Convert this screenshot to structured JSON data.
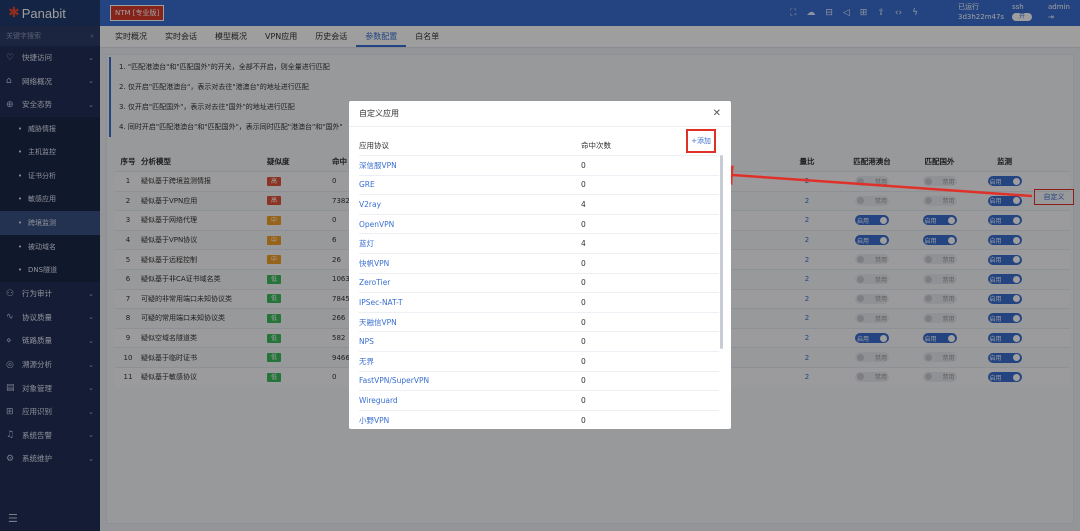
{
  "topbar": {
    "logo": "Panabit",
    "edition": "NTM [专业版]",
    "uptime_label": "已运行",
    "uptime": "3d3h22m47s",
    "ssh": "ssh",
    "ssh_toggle": "开",
    "admin": "admin"
  },
  "sidebar": {
    "search_placeholder": "关键字搜索",
    "items": [
      {
        "label": "快捷访问",
        "icon": "♡"
      },
      {
        "label": "网络概况",
        "icon": "⌂"
      },
      {
        "label": "安全态势",
        "icon": "⊕"
      }
    ],
    "subitems": [
      {
        "label": "威胁情报"
      },
      {
        "label": "主机监控"
      },
      {
        "label": "证书分析"
      },
      {
        "label": "敏感应用"
      },
      {
        "label": "跨境监测"
      },
      {
        "label": "被动域名"
      },
      {
        "label": "DNS隧道"
      }
    ],
    "items2": [
      {
        "label": "行为审计",
        "icon": "⚇"
      },
      {
        "label": "协议质量",
        "icon": "∿"
      },
      {
        "label": "链路质量",
        "icon": "⋄"
      },
      {
        "label": "溯源分析",
        "icon": "◎"
      },
      {
        "label": "对象管理",
        "icon": "▤"
      },
      {
        "label": "应用识别",
        "icon": "⊞"
      },
      {
        "label": "系统告警",
        "icon": "♫"
      },
      {
        "label": "系统维护",
        "icon": "⚙"
      }
    ]
  },
  "tabs": [
    "实时概况",
    "实时会话",
    "模型概况",
    "VPN应用",
    "历史会话",
    "参数配置",
    "白名单"
  ],
  "notes": [
    "1. \"匹配港澳台\"和\"匹配国外\"的开关，全部不开启，则全量进行匹配",
    "2. 仅开启\"匹配港澳台\"，表示对去往\"港澳台\"的地址进行匹配",
    "3. 仅开启\"匹配国外\"，表示对去往\"国外\"的地址进行匹配",
    "4. 同时开启\"匹配港澳台\"和\"匹配国外\"，表示同时匹配\"港澳台\"和\"国外\""
  ],
  "table": {
    "headers": {
      "no": "序号",
      "model": "分析模型",
      "level": "疑似度",
      "hits": "命中",
      "count": "量比",
      "hkmt": "匹配港澳台",
      "foreign": "匹配国外",
      "monitor": "监测"
    },
    "rows": [
      {
        "no": "1",
        "model": "疑似基于跨境监测情报",
        "level": "高",
        "lv": "hi",
        "hits": "0",
        "count": "2",
        "hkmt": "禁用",
        "hk_on": false,
        "foreign": "禁用",
        "fo_on": false,
        "monitor": "启用"
      },
      {
        "no": "2",
        "model": "疑似基于VPN应用",
        "level": "高",
        "lv": "hi",
        "hits": "7382",
        "count": "2",
        "hkmt": "禁用",
        "hk_on": false,
        "foreign": "禁用",
        "fo_on": false,
        "monitor": "启用"
      },
      {
        "no": "3",
        "model": "疑似基于网络代理",
        "level": "中",
        "lv": "mid",
        "hits": "0",
        "count": "2",
        "hkmt": "启用",
        "hk_on": true,
        "foreign": "启用",
        "fo_on": true,
        "monitor": "启用"
      },
      {
        "no": "4",
        "model": "疑似基于VPN协议",
        "level": "中",
        "lv": "mid",
        "hits": "6",
        "count": "2",
        "hkmt": "启用",
        "hk_on": true,
        "foreign": "启用",
        "fo_on": true,
        "monitor": "启用"
      },
      {
        "no": "5",
        "model": "疑似基于远程控制",
        "level": "中",
        "lv": "mid",
        "hits": "26",
        "count": "2",
        "hkmt": "禁用",
        "hk_on": false,
        "foreign": "禁用",
        "fo_on": false,
        "monitor": "启用"
      },
      {
        "no": "6",
        "model": "疑似基于非CA证书域名类",
        "level": "低",
        "lv": "lo",
        "hits": "1063",
        "count": "2",
        "hkmt": "禁用",
        "hk_on": false,
        "foreign": "禁用",
        "fo_on": false,
        "monitor": "启用"
      },
      {
        "no": "7",
        "model": "可疑的非常用端口未知协议类",
        "level": "低",
        "lv": "lo",
        "hits": "7845",
        "count": "2",
        "hkmt": "禁用",
        "hk_on": false,
        "foreign": "禁用",
        "fo_on": false,
        "monitor": "启用"
      },
      {
        "no": "8",
        "model": "可疑的常用端口未知协议类",
        "level": "低",
        "lv": "lo",
        "hits": "266",
        "count": "2",
        "hkmt": "禁用",
        "hk_on": false,
        "foreign": "禁用",
        "fo_on": false,
        "monitor": "启用"
      },
      {
        "no": "9",
        "model": "疑似空域名隧道类",
        "level": "低",
        "lv": "lo",
        "hits": "582",
        "count": "2",
        "hkmt": "启用",
        "hk_on": true,
        "foreign": "启用",
        "fo_on": true,
        "monitor": "启用"
      },
      {
        "no": "10",
        "model": "疑似基于临时证书",
        "level": "低",
        "lv": "lo",
        "hits": "9466",
        "count": "2",
        "hkmt": "禁用",
        "hk_on": false,
        "foreign": "禁用",
        "fo_on": false,
        "monitor": "启用"
      },
      {
        "no": "11",
        "model": "疑似基于敏感协议",
        "level": "低",
        "lv": "lo",
        "hits": "0",
        "count": "2",
        "hkmt": "禁用",
        "hk_on": false,
        "foreign": "禁用",
        "fo_on": false,
        "monitor": "启用"
      }
    ],
    "custom_label": "自定义"
  },
  "modal": {
    "title": "自定义应用",
    "col_protocol": "应用协议",
    "col_hits": "命中次数",
    "add_label": "添加",
    "rows": [
      {
        "p": "深信服VPN",
        "n": "0"
      },
      {
        "p": "GRE",
        "n": "0"
      },
      {
        "p": "V2ray",
        "n": "4"
      },
      {
        "p": "OpenVPN",
        "n": "0"
      },
      {
        "p": "蓝灯",
        "n": "4"
      },
      {
        "p": "快帆VPN",
        "n": "0"
      },
      {
        "p": "ZeroTier",
        "n": "0"
      },
      {
        "p": "IPSec-NAT-T",
        "n": "0"
      },
      {
        "p": "天融信VPN",
        "n": "0"
      },
      {
        "p": "NPS",
        "n": "0"
      },
      {
        "p": "无界",
        "n": "0"
      },
      {
        "p": "FastVPN/SuperVPN",
        "n": "0"
      },
      {
        "p": "Wireguard",
        "n": "0"
      },
      {
        "p": "小野VPN",
        "n": "0"
      }
    ]
  },
  "colors": {
    "brand": "#3a6fd0",
    "sidebar": "#223057",
    "annotation": "#e0302a"
  }
}
